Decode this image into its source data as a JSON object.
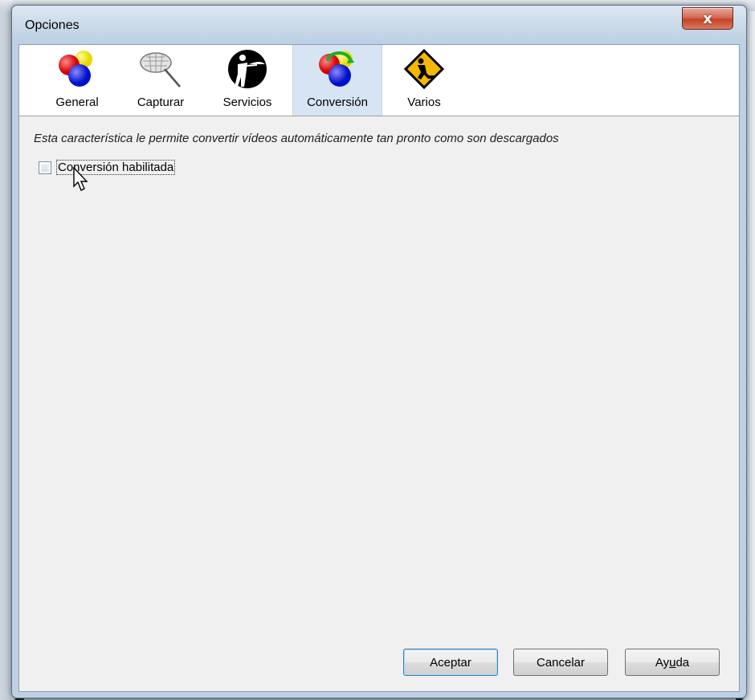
{
  "window": {
    "title": "Opciones",
    "close_symbol": "x"
  },
  "tabs": [
    {
      "label": "General",
      "icon": "colored-balls-icon",
      "selected": false
    },
    {
      "label": "Capturar",
      "icon": "butterfly-net-icon",
      "selected": false
    },
    {
      "label": "Servicios",
      "icon": "waiter-serving-icon",
      "selected": false
    },
    {
      "label": "Conversión",
      "icon": "conversion-balls-arrows-icon",
      "selected": true
    },
    {
      "label": "Varios",
      "icon": "under-construction-sign-icon",
      "selected": false
    }
  ],
  "content": {
    "description": "Esta característica le permite convertir vídeos automáticamente tan pronto como son descargados",
    "checkbox_label": "Conversión habilitada",
    "checkbox_checked": false
  },
  "buttons": {
    "accept": "Aceptar",
    "cancel": "Cancelar",
    "help_pre": "Ay",
    "help_mnemonic": "u",
    "help_post": "da"
  },
  "colors": {
    "selected_tab": "#d6e4f3",
    "close_button": "#c44326",
    "default_button_border": "#3c7fb1"
  }
}
